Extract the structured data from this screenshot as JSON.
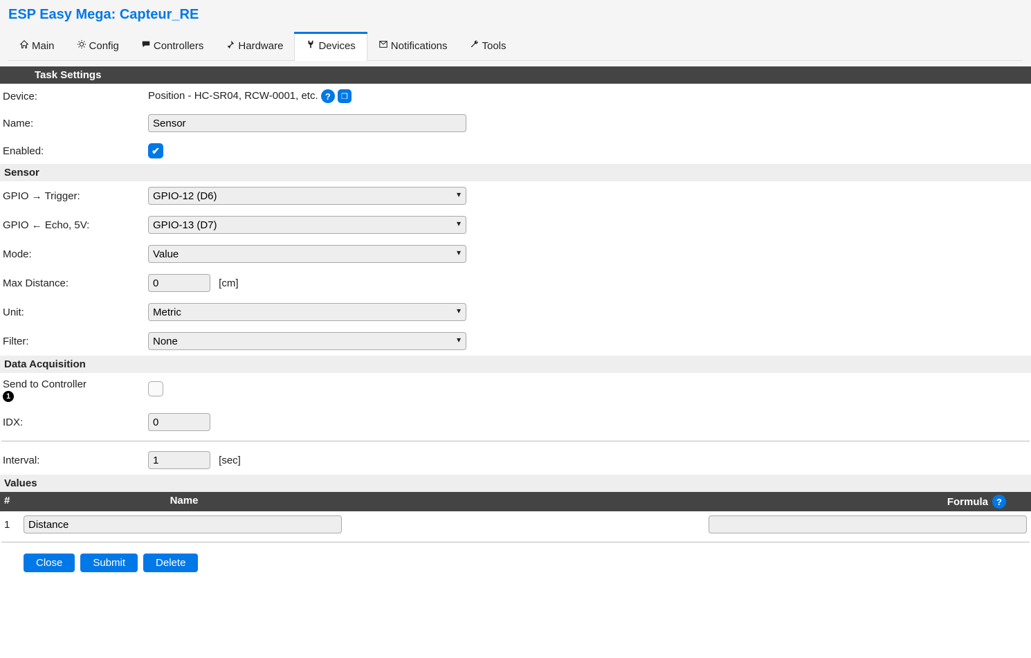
{
  "header": {
    "title": "ESP Easy Mega: Capteur_RE"
  },
  "tabs": [
    {
      "id": "main",
      "label": "Main",
      "icon": "home-icon"
    },
    {
      "id": "config",
      "label": "Config",
      "icon": "gear-icon"
    },
    {
      "id": "controllers",
      "label": "Controllers",
      "icon": "chat-icon"
    },
    {
      "id": "hardware",
      "label": "Hardware",
      "icon": "pin-icon"
    },
    {
      "id": "devices",
      "label": "Devices",
      "icon": "plug-icon",
      "active": true
    },
    {
      "id": "notifications",
      "label": "Notifications",
      "icon": "mail-icon"
    },
    {
      "id": "tools",
      "label": "Tools",
      "icon": "wrench-icon"
    }
  ],
  "sections": {
    "task_settings": "Task Settings",
    "sensor": "Sensor",
    "data_acq": "Data Acquisition",
    "values": "Values"
  },
  "labels": {
    "device": "Device:",
    "name": "Name:",
    "enabled": "Enabled:",
    "gpio_trigger": "GPIO → Trigger:",
    "gpio_echo": "GPIO ← Echo, 5V:",
    "mode": "Mode:",
    "max_distance": "Max Distance:",
    "unit": "Unit:",
    "filter": "Filter:",
    "send_controller": "Send to Controller",
    "idx": "IDX:",
    "interval": "Interval:",
    "cm_suffix": "[cm]",
    "sec_suffix": "[sec]"
  },
  "fields": {
    "device_value": "Position - HC-SR04, RCW-0001, etc.",
    "name_value": "Sensor",
    "enabled": true,
    "gpio_trigger_value": "GPIO-12 (D6)",
    "gpio_echo_value": "GPIO-13 (D7)",
    "mode_value": "Value",
    "max_distance_value": "0",
    "unit_value": "Metric",
    "filter_value": "None",
    "send_controller_checked": false,
    "controller_badge": "1",
    "idx_value": "0",
    "interval_value": "1"
  },
  "values_table": {
    "headers": {
      "idx": "#",
      "name": "Name",
      "formula": "Formula"
    },
    "rows": [
      {
        "idx": "1",
        "name": "Distance",
        "formula": ""
      }
    ]
  },
  "buttons": {
    "close": "Close",
    "submit": "Submit",
    "delete": "Delete"
  }
}
